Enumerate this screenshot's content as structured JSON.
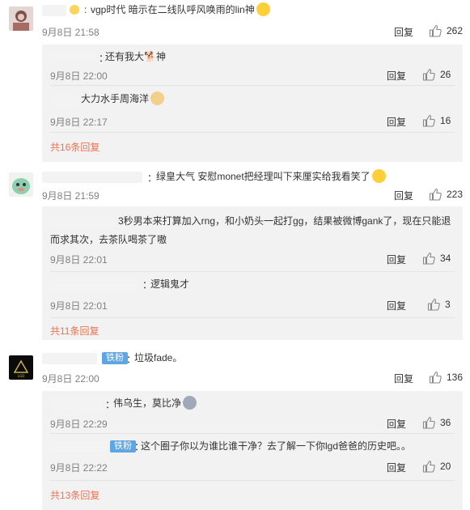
{
  "reply_label": "回复",
  "comments": [
    {
      "text": "vgp时代 暗示在二线队呼风唤雨的lin神",
      "date": "9月8日 21:58",
      "likes": "262",
      "replies": [
        {
          "text": "还有我大🐕神",
          "date": "9月8日 22:00",
          "likes": "26"
        },
        {
          "text": "大力水手周海洋",
          "date": "9月8日 22:17",
          "likes": "16"
        }
      ],
      "total": "共16条回复"
    },
    {
      "text": "绿皇大气 安慰monet把经理叫下来厘实给我看笑了",
      "date": "9月8日 21:59",
      "likes": "223",
      "replies": [
        {
          "text": "3秒男本来打算加入rng，和小奶头一起打gg，结果被微博gank了，现在只能退",
          "text2": "而求其次，去茶队喝茶了嗷",
          "date": "9月8日 22:01",
          "likes": "34"
        },
        {
          "text": "逻辑鬼才",
          "date": "9月8日 22:01",
          "likes": "3"
        }
      ],
      "total": "共11条回复"
    },
    {
      "badge": "铁粉",
      "text": "垃圾fade。",
      "date": "9月8日 22:00",
      "likes": "136",
      "replies": [
        {
          "text": "伟乌生，莫比净",
          "date": "9月8日 22:29",
          "likes": "36"
        },
        {
          "badge": "铁粉",
          "text": "这个圈子你以为谁比谁干净？去了解一下你lgd爸爸的历史吧。。",
          "date": "9月8日 22:22",
          "likes": "20"
        }
      ],
      "total": "共13条回复"
    }
  ],
  "colors": {
    "link": "#eb7350",
    "badge": "#5ea6e3",
    "reply_bg": "#f2f2f2"
  }
}
